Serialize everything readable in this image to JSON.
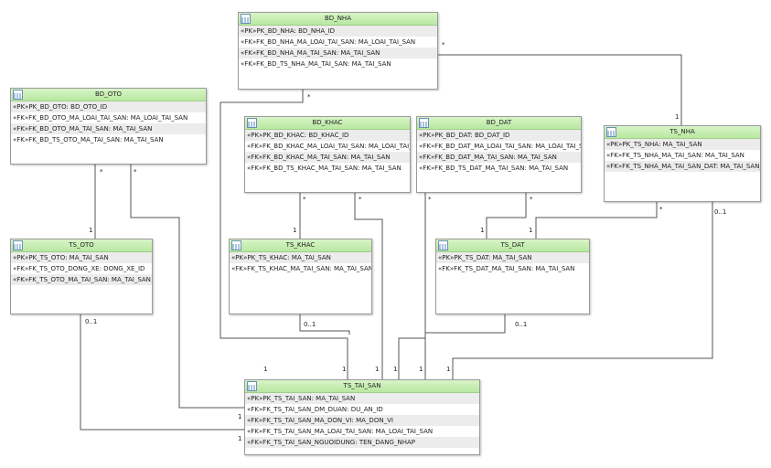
{
  "tables": {
    "bd_nha": {
      "title": "BD_NHA",
      "rows": [
        "«PK»PK_BD_NHA: BD_NHA_ID",
        "«FK»FK_BD_NHA_MA_LOAI_TAI_SAN: MA_LOAI_TAI_SAN",
        "«FK»FK_BD_NHA_MA_TAI_SAN: MA_TAI_SAN",
        "«FK»FK_BD_TS_NHA_MA_TAI_SAN: MA_TAI_SAN"
      ]
    },
    "bd_oto": {
      "title": "BD_OTO",
      "rows": [
        "«PK»PK_BD_OTO: BD_OTO_ID",
        "«FK»FK_BD_OTO_MA_LOAI_TAI_SAN: MA_LOAI_TAI_SAN",
        "«FK»FK_BD_OTO_MA_TAI_SAN: MA_TAI_SAN",
        "«FK»FK_BD_TS_OTO_MA_TAI_SAN: MA_TAI_SAN"
      ]
    },
    "bd_khac": {
      "title": "BD_KHAC",
      "rows": [
        "«PK»PK_BD_KHAC: BD_KHAC_ID",
        "«FK»FK_BD_KHAC_MA_LOAI_TAI_SAN: MA_LOAI_TAI_SAN",
        "«FK»FK_BD_KHAC_MA_TAI_SAN: MA_TAI_SAN",
        "«FK»FK_BD_TS_KHAC_MA_TAI_SAN: MA_TAI_SAN"
      ]
    },
    "bd_dat": {
      "title": "BD_DAT",
      "rows": [
        "«PK»PK_BD_DAT: BD_DAT_ID",
        "«FK»FK_BD_DAT_MA_LOAI_TAI_SAN: MA_LOAI_TAI_SAN",
        "«FK»FK_BD_DAT_MA_TAI_SAN: MA_TAI_SAN",
        "«FK»FK_BD_TS_DAT_MA_TAI_SAN: MA_TAI_SAN"
      ]
    },
    "ts_nha": {
      "title": "TS_NHA",
      "rows": [
        "«PK»PK_TS_NHA: MA_TAI_SAN",
        "«FK»FK_TS_NHA_MA_TAI_SAN: MA_TAI_SAN",
        "«FK»FK_TS_NHA_MA_TAI_SAN_DAT: MA_TAI_SAN_DAT"
      ]
    },
    "ts_oto": {
      "title": "TS_OTO",
      "rows": [
        "«PK»PK_TS_OTO: MA_TAI_SAN",
        "«FK»FK_TS_OTO_DONG_XE: DONG_XE_ID",
        "«FK»FK_TS_OTO_MA_TAI_SAN: MA_TAI_SAN"
      ]
    },
    "ts_khac": {
      "title": "TS_KHAC",
      "rows": [
        "«PK»PK_TS_KHAC: MA_TAI_SAN",
        "«FK»FK_TS_KHAC_MA_TAI_SAN: MA_TAI_SAN"
      ]
    },
    "ts_dat": {
      "title": "TS_DAT",
      "rows": [
        "«PK»PK_TS_DAT: MA_TAI_SAN",
        "«FK»FK_TS_DAT_MA_TAI_SAN: MA_TAI_SAN"
      ]
    },
    "ts_tai_san": {
      "title": "TS_TAI_SAN",
      "rows": [
        "«PK»PK_TS_TAI_SAN: MA_TAI_SAN",
        "«FK»FK_TS_TAI_SAN_DM_DUAN: DU_AN_ID",
        "«FK»FK_TS_TAI_SAN_MA_DON_VI: MA_DON_VI",
        "«FK»FK_TS_TAI_SAN_MA_LOAI_TAI_SAN: MA_LOAI_TAI_SAN",
        "«FK»FK_TS_TAI_SAN_NGUOIDUNG: TEN_DANG_NHAP"
      ]
    }
  },
  "multiplicities": {
    "many": "*",
    "one": "1",
    "zero_or_one": "0..1"
  },
  "colors": {
    "header": "#c6edb2",
    "border": "#9a9a9a",
    "line": "#555555"
  }
}
